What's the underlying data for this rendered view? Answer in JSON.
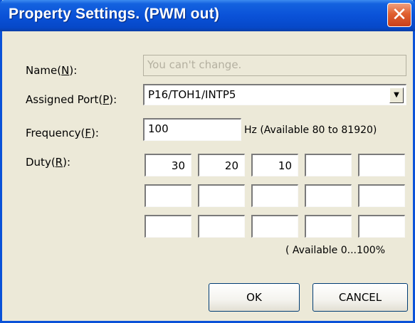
{
  "window": {
    "title": "Property Settings. (PWM out)",
    "close_glyph": "✕"
  },
  "form": {
    "name_label_pre": "Name(",
    "name_label_key": "N",
    "name_label_post": "):",
    "name_value": "You can't change.",
    "port_label_pre": "Assigned Port(",
    "port_label_key": "P",
    "port_label_post": "):",
    "port_value": "P16/TOH1/INTP5",
    "dropdown_glyph": "▼",
    "freq_label_pre": "Frequency(",
    "freq_label_key": "F",
    "freq_label_post": "):",
    "freq_value": "100",
    "freq_hint": "Hz (Available 80 to 81920)",
    "duty_label_pre": "Duty(",
    "duty_label_key": "R",
    "duty_label_post": "):",
    "duty_rows": [
      [
        "30",
        "20",
        "10",
        "",
        ""
      ],
      [
        "",
        "",
        "",
        "",
        ""
      ],
      [
        "",
        "",
        "",
        "",
        ""
      ]
    ],
    "duty_hint": "( Available 0...100%"
  },
  "buttons": {
    "ok": "OK",
    "cancel": "CANCEL"
  }
}
